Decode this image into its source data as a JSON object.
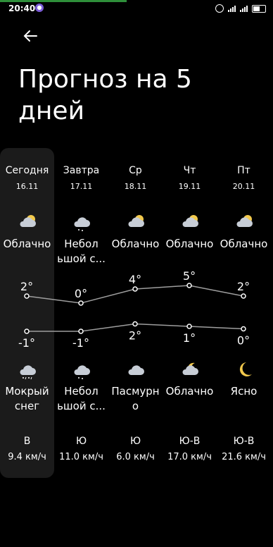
{
  "status": {
    "time": "20:40",
    "battery": 0.5
  },
  "header": {
    "title": "Прогноз на 5 дней"
  },
  "days": [
    {
      "day": "Сегодня",
      "date": "16.11",
      "cond_day": "Облачно",
      "icon_day": "partly-cloudy-day-icon",
      "cond_night_l1": "Мокрый",
      "cond_night_l2": "снег",
      "icon_night": "sleet-icon",
      "wind_dir": "В",
      "wind_speed": "9.4 км/ч",
      "hi": "2°",
      "lo": "-1°"
    },
    {
      "day": "Завтра",
      "date": "17.11",
      "cond_day": "Небол",
      "cond_day_l2": "ьшой с...",
      "icon_day": "light-snow-icon",
      "cond_night_l1": "Небол",
      "cond_night_l2": "ьшой с...",
      "icon_night": "light-snow-icon",
      "wind_dir": "Ю",
      "wind_speed": "11.0 км/ч",
      "hi": "0°",
      "lo": "-1°"
    },
    {
      "day": "Ср",
      "date": "18.11",
      "cond_day": "Облачно",
      "icon_day": "partly-cloudy-day-icon",
      "cond_night_l1": "Пасмурн",
      "cond_night_l2": "о",
      "icon_night": "overcast-icon",
      "wind_dir": "Ю",
      "wind_speed": "6.0 км/ч",
      "hi": "4°",
      "lo": "2°"
    },
    {
      "day": "Чт",
      "date": "19.11",
      "cond_day": "Облачно",
      "icon_day": "partly-cloudy-day-icon",
      "cond_night_l1": "Облачно",
      "cond_night_l2": "",
      "icon_night": "partly-cloudy-night-icon",
      "wind_dir": "Ю-В",
      "wind_speed": "17.0 км/ч",
      "hi": "5°",
      "lo": "1°"
    },
    {
      "day": "Пт",
      "date": "20.11",
      "cond_day": "Облачно",
      "icon_day": "partly-cloudy-day-icon",
      "cond_night_l1": "Ясно",
      "cond_night_l2": "",
      "icon_night": "clear-night-icon",
      "wind_dir": "Ю-В",
      "wind_speed": "21.6 км/ч",
      "hi": "2°",
      "lo": "0°"
    }
  ],
  "chart_data": {
    "type": "line",
    "categories": [
      "16.11",
      "17.11",
      "18.11",
      "19.11",
      "20.11"
    ],
    "series": [
      {
        "values": [
          2,
          0,
          4,
          5,
          2
        ]
      },
      {
        "values": [
          -1,
          -1,
          2,
          1,
          0
        ]
      }
    ],
    "colors": {
      "line": "#9e9e9e",
      "point": "#ffffff"
    }
  }
}
